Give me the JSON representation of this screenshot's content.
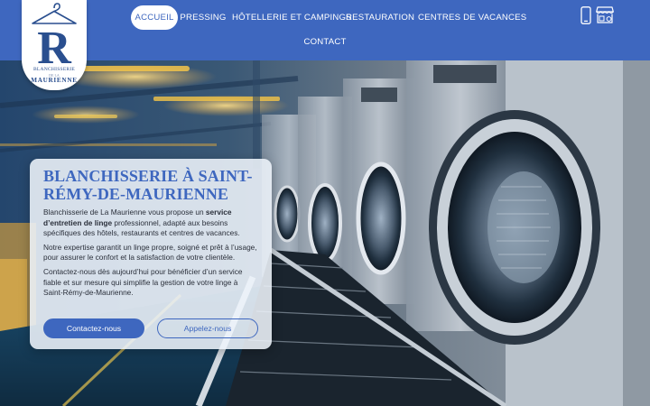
{
  "logo": {
    "letter": "R",
    "word_1": "BLANCHISSERIE",
    "word_2": "DE LA",
    "word_3": "MAURIENNE"
  },
  "nav": {
    "items": [
      {
        "label": "ACCUEIL",
        "active": true
      },
      {
        "label": "PRESSING"
      },
      {
        "label": "HÔTELLERIE ET CAMPINGS"
      },
      {
        "label": "RESTAURATION"
      },
      {
        "label": "CENTRES DE VACANCES"
      },
      {
        "label": "CONTACT"
      }
    ]
  },
  "header_icons": [
    "phone-icon",
    "shop-icon"
  ],
  "hero": {
    "title": "Blanchisserie à Saint-Rémy-de-Maurienne",
    "p1_a": "Blanchisserie de La Maurienne vous propose un ",
    "p1_b": "service d’entretien de linge",
    "p1_c": " professionnel, adapté aux besoins spécifiques des hôtels, restaurants et centres de vacances.",
    "p2": "Notre expertise garantit un linge propre, soigné et prêt à l’usage, pour assurer le confort et la satisfaction de votre clientèle.",
    "p3": "Contactez-nous dès aujourd’hui pour bénéficier d’un service fiable et sur mesure qui simplifie la gestion de votre linge à Saint-Rémy-de-Maurienne.",
    "btn_contact": "Contactez-nous",
    "btn_call": "Appelez-nous"
  },
  "colors": {
    "brand_blue": "#3e67bf",
    "card_bg": "#eef4fb",
    "text_dark": "#2a2f3a"
  }
}
